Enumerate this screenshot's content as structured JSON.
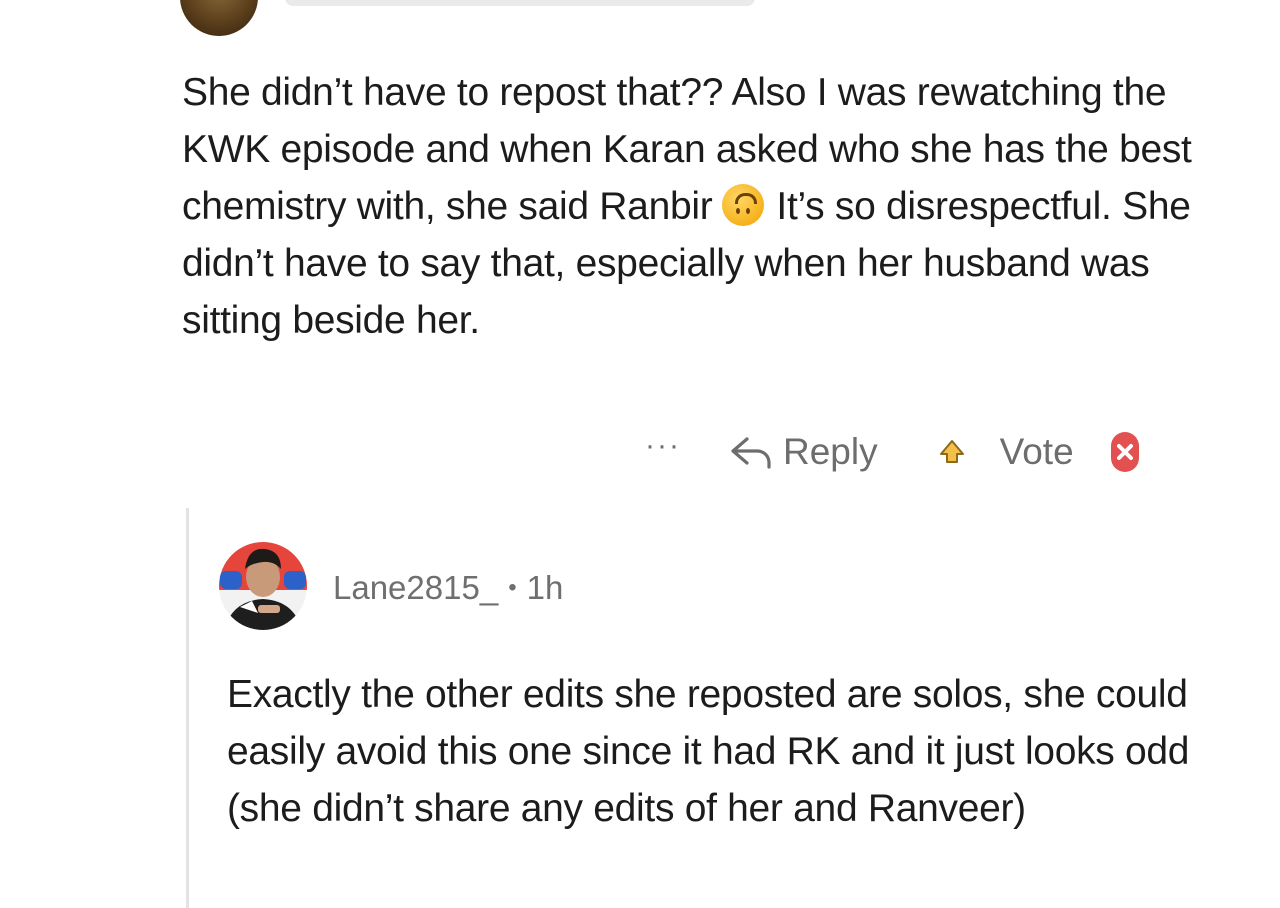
{
  "comment": {
    "text_before_emoji": "She didn’t have to repost that?? Also I was rewatching the KWK episode and when Karan asked who she has the best chemistry with, she said Ranbir",
    "emoji_icon": "upside-down-face-emoji",
    "text_after_emoji": "It’s so disrespectful. She didn’t have to say that, especially when her husband was sitting beside her."
  },
  "actions": {
    "more_label": "···",
    "reply_label": "Reply",
    "vote_label": "Vote",
    "upvote_color": "#e8a317",
    "downvote_color": "#e03e3e"
  },
  "reply": {
    "username": "Lane2815_",
    "separator": "•",
    "time": "1h",
    "text": "Exactly the other edits she reposted are solos, she could easily avoid this one since it had RK and it just looks odd (she didn’t share any edits of her and Ranveer)"
  }
}
